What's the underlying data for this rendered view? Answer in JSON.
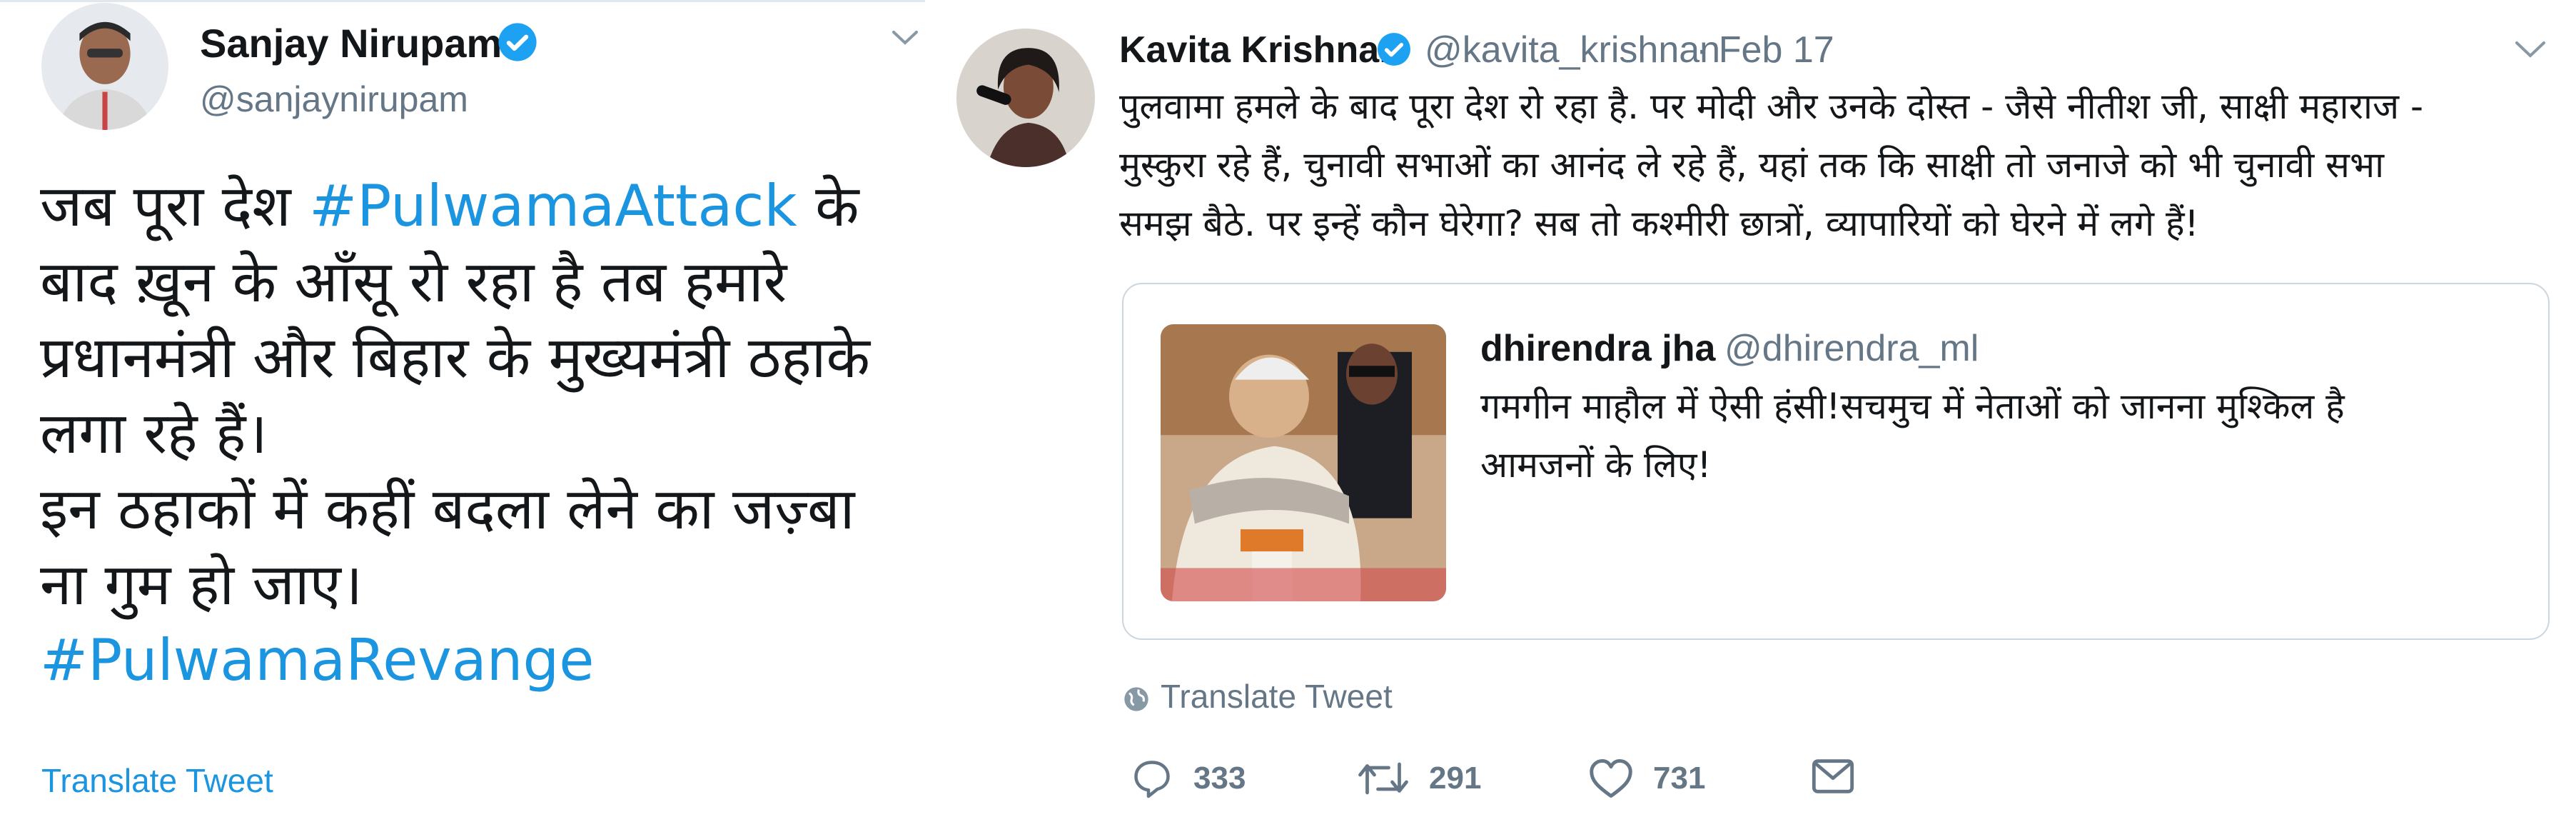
{
  "left_tweet": {
    "author_name": "Sanjay Nirupam",
    "author_handle": "@sanjaynirupam",
    "body": [
      {
        "parts": [
          {
            "text": "जब पूरा देश ",
            "link": false
          },
          {
            "text": "#PulwamaAttack",
            "link": true
          },
          {
            "text": " के",
            "link": false
          }
        ]
      },
      {
        "parts": [
          {
            "text": "बाद ख़ून के आँसू रो रहा है तब हमारे",
            "link": false
          }
        ]
      },
      {
        "parts": [
          {
            "text": "प्रधानमंत्री और बिहार के मुख्यमंत्री ठहाके",
            "link": false
          }
        ]
      },
      {
        "parts": [
          {
            "text": "लगा रहे हैं।",
            "link": false
          }
        ]
      },
      {
        "parts": [
          {
            "text": "इन ठहाकों में कहीं बदला लेने का जज़्बा",
            "link": false
          }
        ]
      },
      {
        "parts": [
          {
            "text": "ना गुम हो जाए।",
            "link": false
          }
        ]
      },
      {
        "parts": [
          {
            "text": "#PulwamaRevange",
            "link": true
          }
        ]
      }
    ],
    "translate_label": "Translate Tweet"
  },
  "right_tweet": {
    "author_name": "Kavita Krishnan",
    "author_handle": "@kavita_krishnan",
    "date": "· Feb 17",
    "text_lines": [
      "पुलवामा हमले के बाद पूरा देश रो रहा है. पर मोदी और उनके दोस्त - जैसे नीतीश जी, साक्षी महाराज -",
      "मुस्कुरा रहे हैं, चुनावी सभाओं का आनंद ले रहे हैं, यहां तक कि साक्षी तो जनाजे को भी चुनावी सभा",
      "समझ बैठे. पर इन्हें कौन घेरेगा? सब तो कश्मीरी छात्रों, व्यापारियों को घेरने में लगे हैं!"
    ],
    "quote": {
      "name": "dhirendra jha",
      "handle": "@dhirendra_ml",
      "text_lines": [
        "गमगीन माहौल में ऐसी हंसी!सचमुच में नेताओं को जानना मुश्किल है",
        "आमजनों के लिए!"
      ]
    },
    "translate_label": "Translate Tweet",
    "actions": {
      "replies": "333",
      "retweets": "291",
      "likes": "731"
    }
  },
  "colors": {
    "link": "#1b95e0",
    "secondary": "#657786",
    "border": "#ccd6dd",
    "verified": "#1da1f2"
  }
}
